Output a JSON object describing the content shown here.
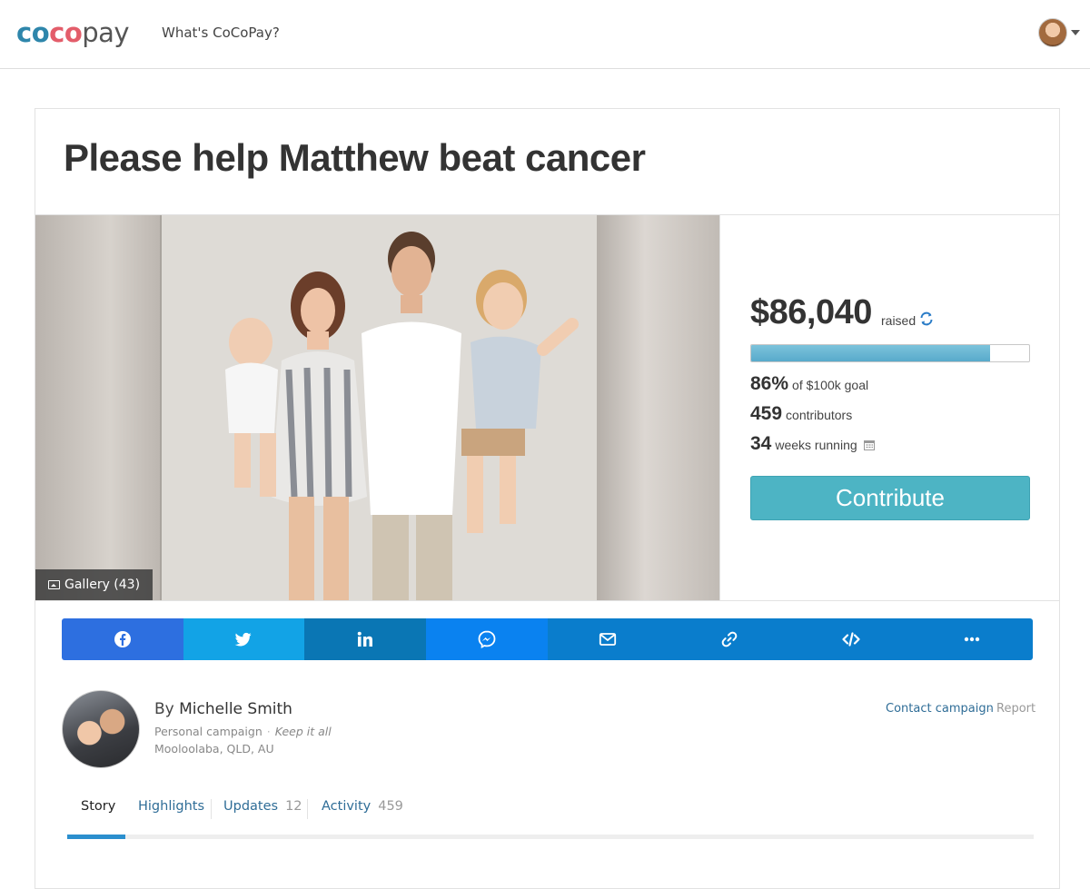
{
  "header": {
    "logo": {
      "part1": "co",
      "part2": "co",
      "part3": "pay"
    },
    "nav_link": "What's CoCoPay?",
    "avatar_icon": "user-avatar"
  },
  "campaign": {
    "title": "Please help Matthew beat cancer",
    "gallery_label": "Gallery (43)",
    "stats": {
      "amount_raised": "$86,040",
      "raised_label": "raised",
      "progress_percent": 86,
      "percent_text": "86%",
      "goal_text": "of $100k goal",
      "contributors_count": "459",
      "contributors_label": "contributors",
      "weeks_count": "34",
      "weeks_label": "weeks running"
    },
    "contribute_label": "Contribute"
  },
  "share_buttons": [
    {
      "name": "facebook",
      "icon": "facebook-icon",
      "color": "#2d6fe0"
    },
    {
      "name": "twitter",
      "icon": "twitter-icon",
      "color": "#12a3e6"
    },
    {
      "name": "linkedin",
      "icon": "linkedin-icon",
      "color": "#0a76b4"
    },
    {
      "name": "messenger",
      "icon": "messenger-icon",
      "color": "#0a82f0"
    },
    {
      "name": "email",
      "icon": "email-icon",
      "color": "#0a7dcc"
    },
    {
      "name": "link",
      "icon": "link-icon",
      "color": "#0a7dcc"
    },
    {
      "name": "embed",
      "icon": "code-icon",
      "color": "#0a7dcc"
    },
    {
      "name": "more",
      "icon": "more-icon",
      "color": "#0a7dcc"
    }
  ],
  "author": {
    "by_prefix": "By",
    "name": "Michelle Smith",
    "campaign_type": "Personal campaign",
    "funding_type": "Keep it all",
    "location": "Mooloolaba, QLD, AU",
    "contact_label": "Contact campaign",
    "report_label": "Report"
  },
  "tabs": [
    {
      "label": "Story",
      "count": "",
      "active": true
    },
    {
      "label": "Highlights",
      "count": "",
      "active": false
    },
    {
      "label": "Updates",
      "count": "12",
      "active": false
    },
    {
      "label": "Activity",
      "count": "459",
      "active": false
    }
  ],
  "colors": {
    "accent": "#2b8fce",
    "contribute": "#4db4c4",
    "progress": "#58aacb",
    "link": "#2f6d97"
  }
}
